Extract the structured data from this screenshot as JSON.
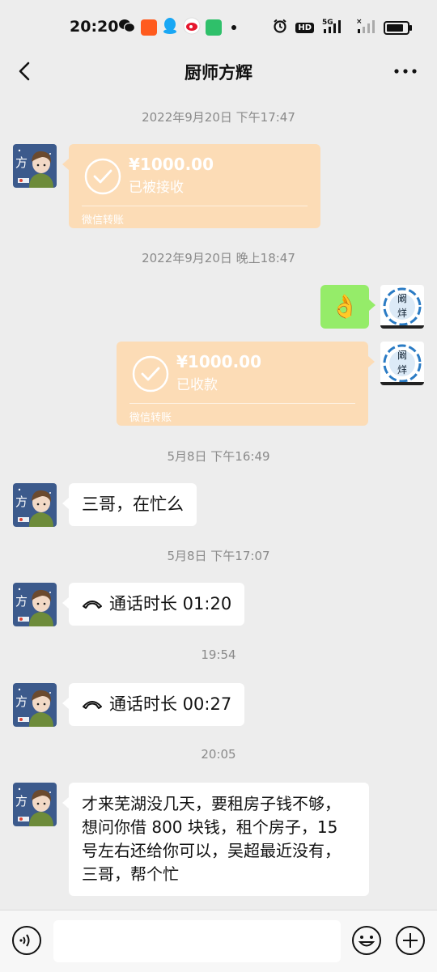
{
  "status_bar": {
    "time": "20:20",
    "hd_label": "HD",
    "network": "5G",
    "battery_level": 0.85,
    "app_icons": [
      "wechat-icon",
      "taobao-icon",
      "qq-icon",
      "weibo-icon",
      "app-store-icon"
    ]
  },
  "header": {
    "title": "厨师方辉",
    "back_icon": "chevron-left-icon",
    "more_icon": "more-dots-icon"
  },
  "messages": {
    "ts1": "2022年9月20日 下午17:47",
    "transfer1": {
      "amount": "¥1000.00",
      "status": "已被接收",
      "source": "微信转账"
    },
    "ts2": "2022年9月20日 晚上18:47",
    "emoji_msg": "👌",
    "transfer2": {
      "amount": "¥1000.00",
      "status": "已收款",
      "source": "微信转账"
    },
    "ts3": "5月8日 下午16:49",
    "text1": "三哥，在忙么",
    "ts4": "5月8日 下午17:07",
    "call1": "通话时长 01:20",
    "ts5": "19:54",
    "call2": "通话时长 00:27",
    "ts6": "20:05",
    "text2": "才来芜湖没几天，要租房子钱不够，想问你借 800 块钱，租个房子，15 号左右还给你可以，吴超最近没有，三哥，帮个忙"
  },
  "avatars": {
    "contact_char": "方",
    "self_seal_chars": "阚\n烊"
  },
  "input_bar": {
    "voice_icon": "voice-icon",
    "emoji_icon": "emoji-icon",
    "plus_icon": "plus-icon",
    "value": ""
  },
  "colors": {
    "background": "#ededed",
    "transfer_bubble": "#fcdcb6",
    "self_bubble": "#95ec69",
    "timestamp": "#8a8a8a"
  }
}
